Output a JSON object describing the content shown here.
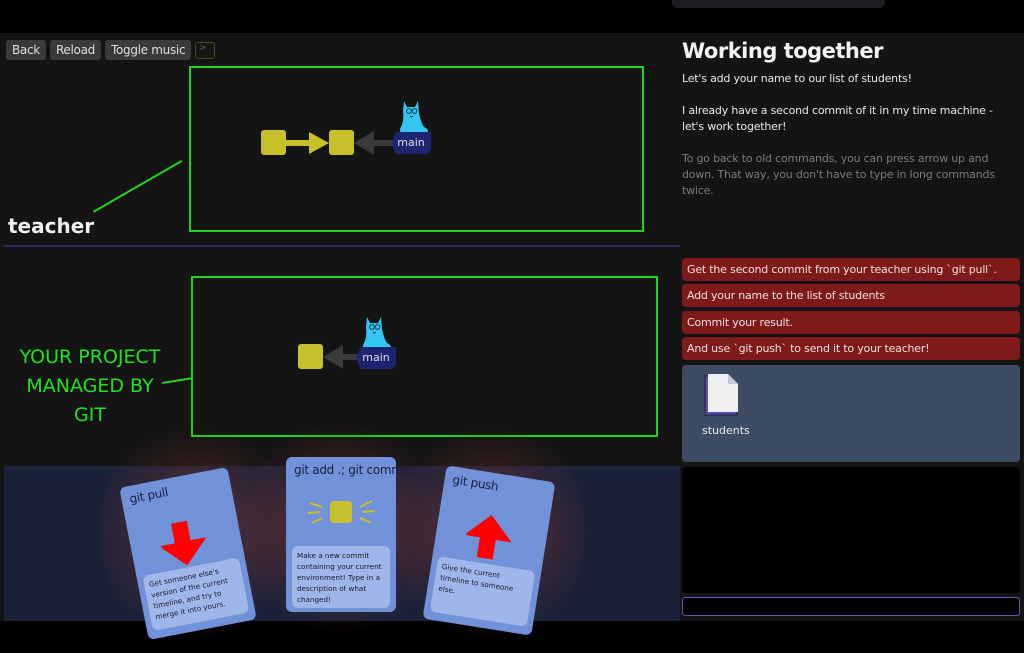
{
  "toolbar": {
    "back_label": "Back",
    "reload_label": "Reload",
    "music_label": "Toggle music",
    "terminal_glyph": ">"
  },
  "repos": {
    "teacher": {
      "label": "teacher",
      "commit_count": 2,
      "branch": "main"
    },
    "yours": {
      "label": "YOUR PROJECT MANAGED BY GIT",
      "label_lines": [
        "YOUR PROJECT",
        "MANAGED BY",
        "GIT"
      ],
      "commit_count": 1,
      "branch": "main"
    }
  },
  "cards": [
    {
      "title": "git pull",
      "icon": "arrow-down-icon",
      "description": "Get someone else's version of the current timeline, and try to merge it into yours."
    },
    {
      "title": "git add .; git commit",
      "icon": "commit-sparkle-icon",
      "description": "Make a new commit containing your current environment! Type in a description of what changed!"
    },
    {
      "title": "git push",
      "icon": "arrow-up-icon",
      "description": "Give the current timeline to someone else."
    }
  ],
  "level": {
    "title": "Working together",
    "intro": "Let's add your name to our list of students!",
    "story": "I already have a second commit of it in my time machine - let's work together!",
    "hint": "To go back to old commands, you can press arrow up and down. That way, you don't have to type in long commands twice."
  },
  "tasks": [
    "Get the second commit from your teacher using `git pull`.",
    "Add your name to the list of students",
    "Commit your result.",
    "And use `git push` to send it to your teacher!"
  ],
  "files": [
    {
      "name": "students",
      "icon": "file-icon"
    }
  ],
  "terminal": {
    "input_value": "",
    "input_placeholder": ""
  },
  "colors": {
    "commit": "#c8c02a",
    "branch": "#1e2570",
    "task_bg": "#7f1a1a",
    "highlight_box": "#1ed41e",
    "card": "#7191d8",
    "files_bg": "#3d4c63"
  }
}
